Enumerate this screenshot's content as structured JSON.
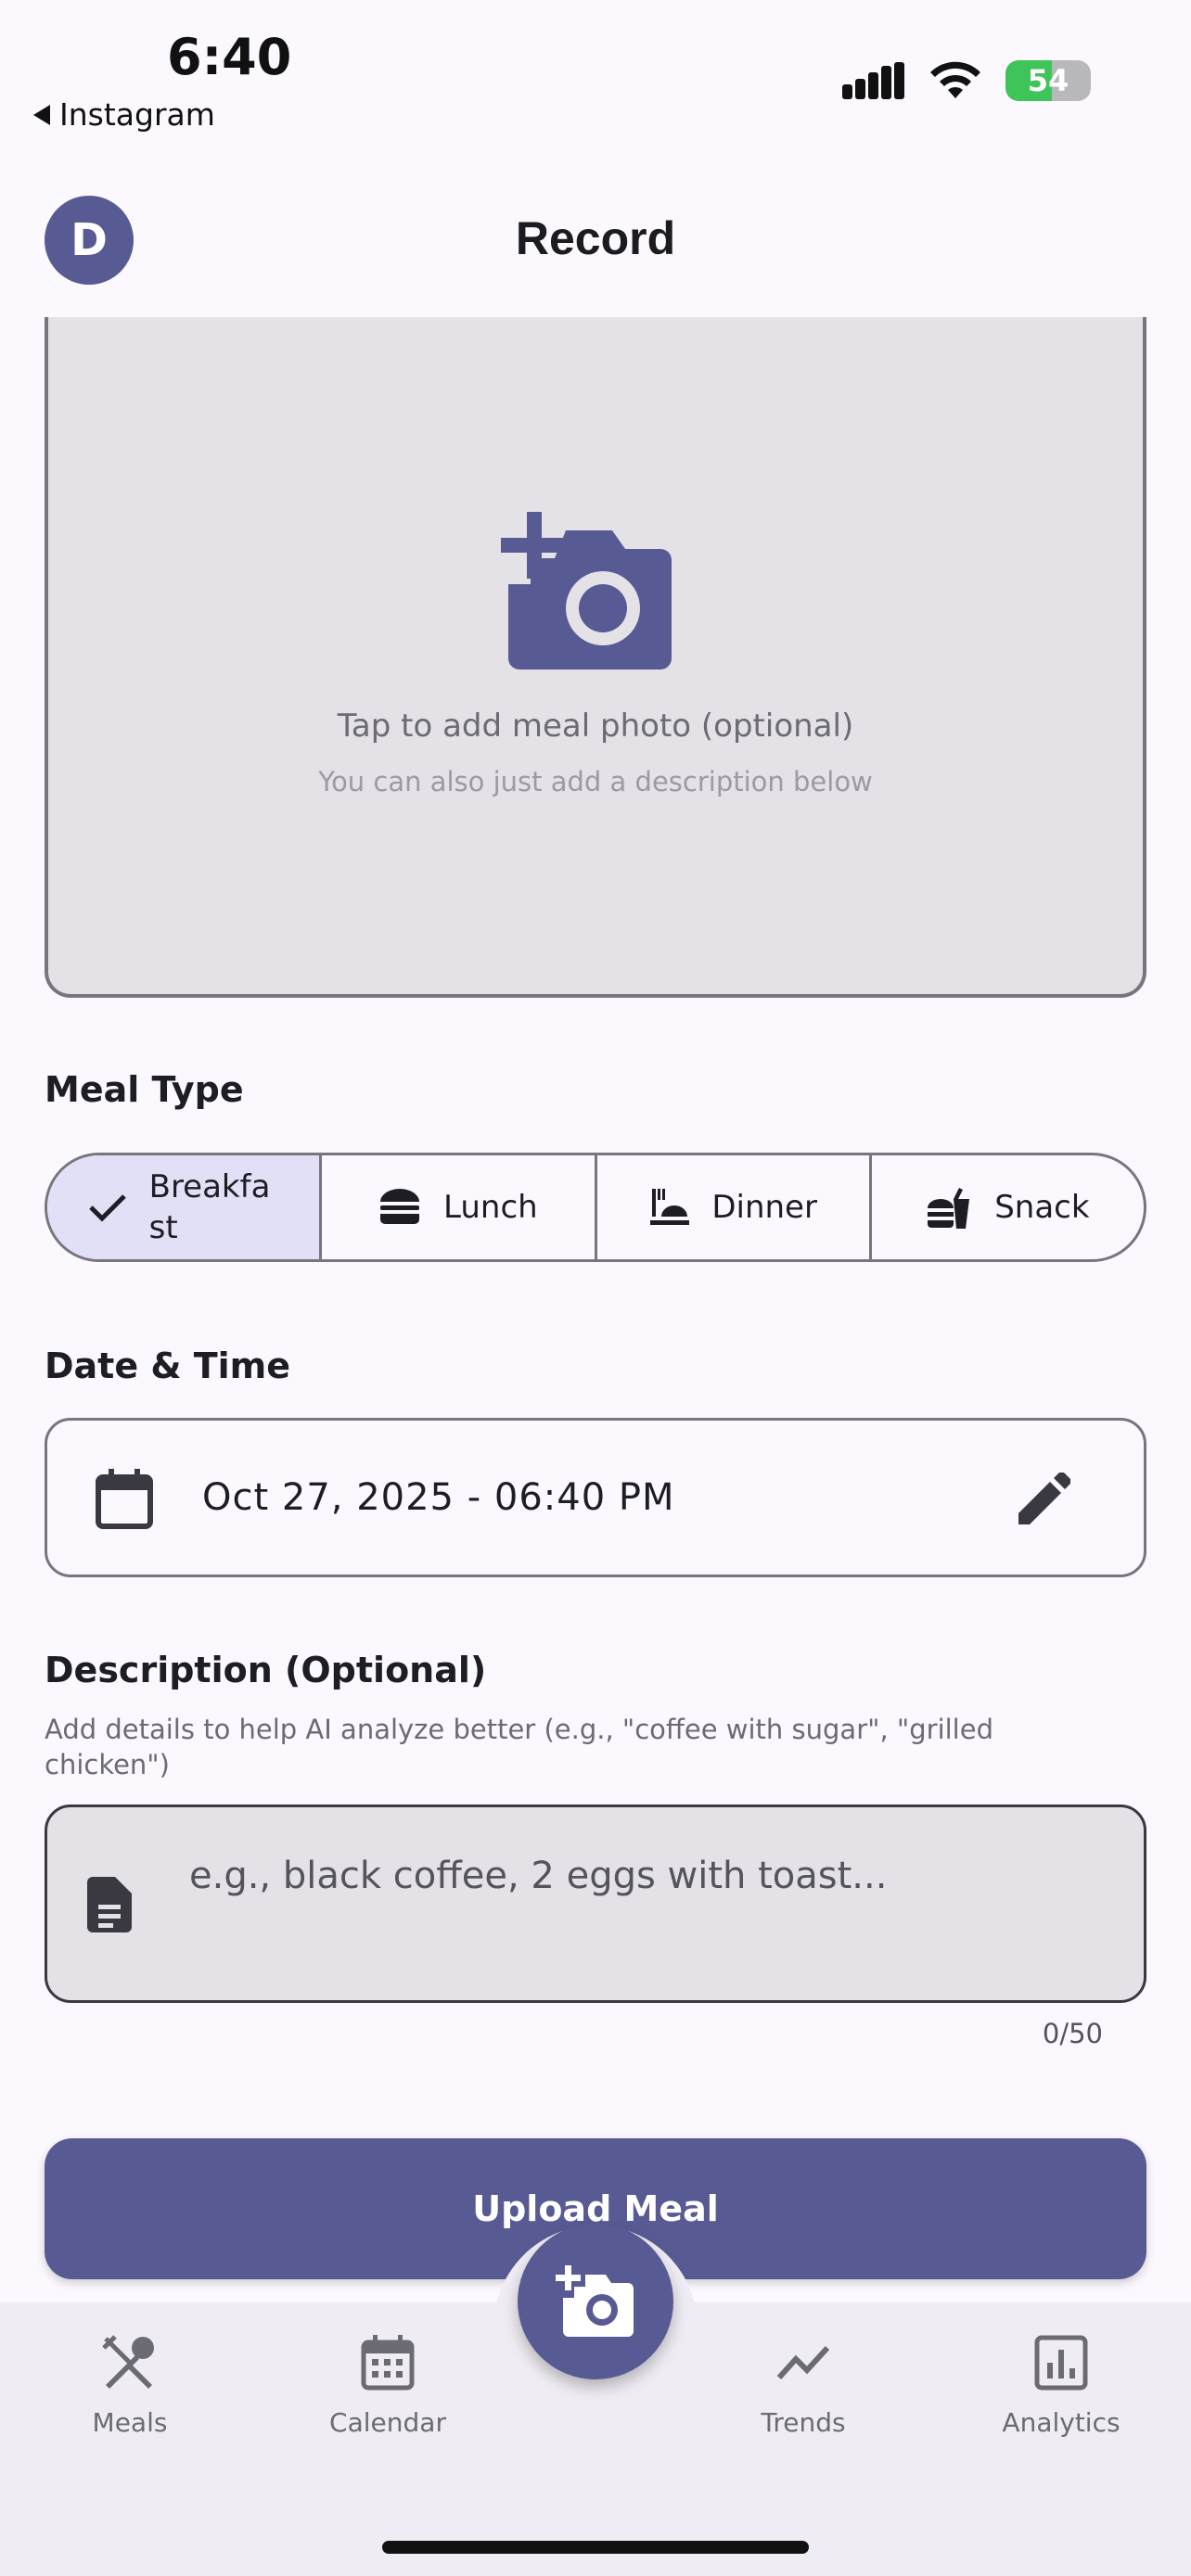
{
  "status_bar": {
    "time": "6:40",
    "back_app": "Instagram",
    "battery_percent": "54",
    "battery_level": 0.54,
    "icons": [
      "signal-icon",
      "wifi-icon",
      "battery-icon"
    ]
  },
  "header": {
    "avatar_initial": "D",
    "title": "Record"
  },
  "photo": {
    "icon": "add-photo-icon",
    "main_text": "Tap to add meal photo (optional)",
    "sub_text": "You can also just add a description below"
  },
  "meal_type": {
    "title": "Meal Type",
    "selected": "Breakfast",
    "options": [
      {
        "label": "Breakfast",
        "display": "Breakfa st",
        "icon": "check-icon"
      },
      {
        "label": "Lunch",
        "icon": "burger-icon"
      },
      {
        "label": "Dinner",
        "icon": "dinner-icon"
      },
      {
        "label": "Snack",
        "icon": "fastfood-icon"
      }
    ]
  },
  "date_time": {
    "title": "Date & Time",
    "value": "Oct 27, 2025 - 06:40 PM"
  },
  "description": {
    "title": "Description (Optional)",
    "help": "Add details to help AI analyze better (e.g., \"coffee with sugar\", \"grilled chicken\")",
    "placeholder": "e.g., black coffee, 2 eggs with toast...",
    "counter": "0/50"
  },
  "upload_button": "Upload Meal",
  "bottom_nav": {
    "items": [
      {
        "label": "Meals",
        "icon": "meals-icon"
      },
      {
        "label": "Calendar",
        "icon": "calendar-icon"
      },
      {
        "label": "Trends",
        "icon": "trends-icon"
      },
      {
        "label": "Analytics",
        "icon": "analytics-icon"
      }
    ],
    "fab_icon": "add-photo-icon"
  },
  "colors": {
    "primary": "#585A93",
    "background": "#FBF8FE",
    "surface": "#E4E2E6",
    "selected_segment": "#E1E0F7",
    "battery_green": "#3FC45A"
  }
}
